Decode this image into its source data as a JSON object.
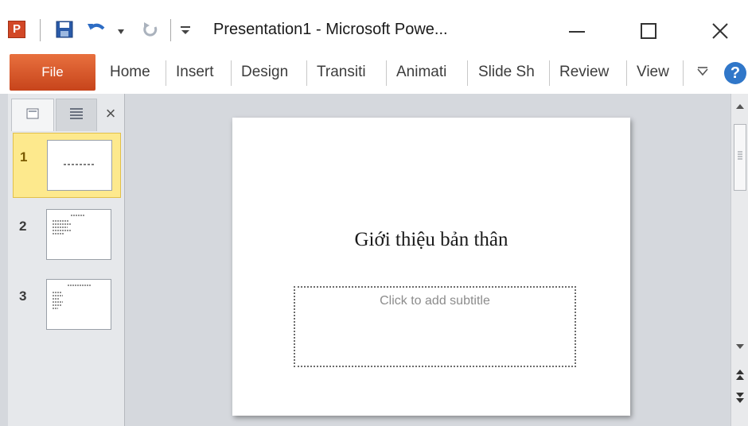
{
  "titlebar": {
    "app_logo_letter": "P",
    "title": "Presentation1 - Microsoft Powe...",
    "icons": [
      "powerpoint-logo-icon",
      "save-icon",
      "undo-icon",
      "undo-dropdown-icon",
      "redo-icon",
      "customize-qat-icon",
      "minimize-icon",
      "maximize-icon",
      "close-icon"
    ]
  },
  "ribbon": {
    "file_tab": "File",
    "tabs": [
      "Home",
      "Insert",
      "Design",
      "Transiti",
      "Animati",
      "Slide Sh",
      "Review",
      "View"
    ],
    "help_label": "?",
    "accent_color": "#d24726"
  },
  "slides_pane": {
    "close_label": "×",
    "thumbnails": [
      {
        "number": "1",
        "selected": true
      },
      {
        "number": "2",
        "selected": false
      },
      {
        "number": "3",
        "selected": false
      }
    ]
  },
  "slide": {
    "title": "Giới thiệu bản thân",
    "subtitle_placeholder": "Click to add subtitle"
  }
}
